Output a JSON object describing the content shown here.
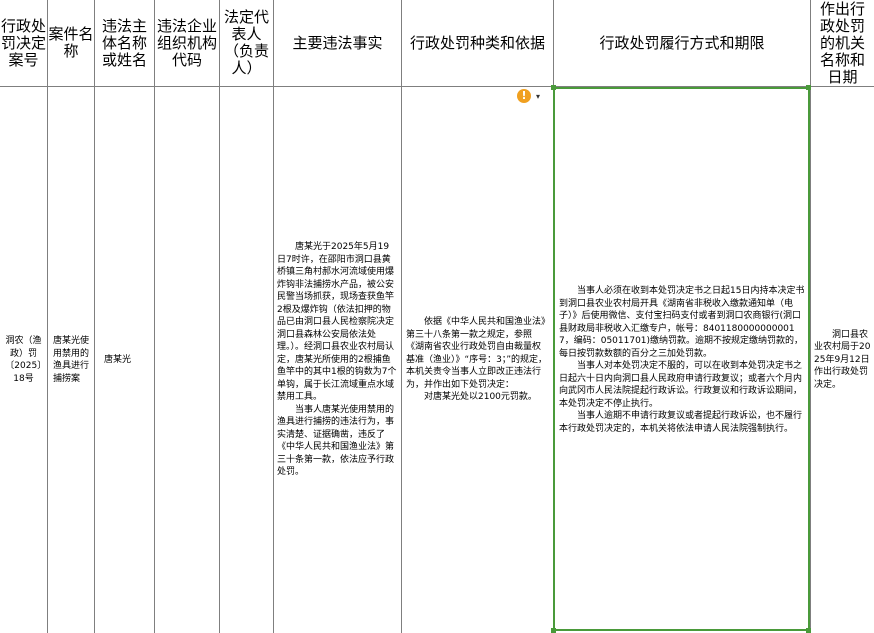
{
  "headers": [
    "行政处罚决定案号",
    "案件名称",
    "违法主体名称或姓名",
    "违法企业组织机构代码",
    "法定代表人（负责人）",
    "主要违法事实",
    "行政处罚种类和依据",
    "行政处罚履行方式和期限",
    "作出行政处罚的机关名称和日期"
  ],
  "row": {
    "case_no": "洞农（渔政）罚〔2025〕18号",
    "case_name": "唐某光使用禁用的渔具进行捕捞案",
    "party_name": "唐某光",
    "org_code": "",
    "legal_rep": "",
    "facts": [
      "唐某光于2025年5月19日7时许，在邵阳市洞口县黄桥镇三角村郝水河流域使用爆炸钩非法捕捞水产品，被公安民警当场抓获，现场查获鱼竿2根及爆炸钩（依法扣押的物品已由洞口县人民检察院决定洞口县森林公安局依法处理。）。经洞口县农业农村局认定，唐某光所使用的2根捕鱼鱼竿中的其中1根的钩数为7个单钩，属于长江流域重点水域禁用工具。",
      "当事人唐某光使用禁用的渔具进行捕捞的违法行为，事实清楚、证据确凿，违反了《中华人民共和国渔业法》第三十条第一款，依法应予行政处罚。"
    ],
    "penalty": [
      "依据《中华人民共和国渔业法》第三十八条第一款之规定，参照《湖南省农业行政处罚自由裁量权基准（渔业）》“序号：3；”的规定，本机关责令当事人立即改正违法行为，并作出如下处罚决定：",
      "对唐某光处以2100元罚款。"
    ],
    "performance": [
      "当事人必须在收到本处罚决定书之日起15日内持本决定书到洞口县农业农村局开具《湖南省非税收入缴款通知单（电子）》后使用微信、支付宝扫码支付或者到洞口农商银行(洞口县财政局非税收入汇缴专户，帐号：84011800000000017，编码：05011701)缴纳罚款。逾期不按规定缴纳罚款的，每日按罚款数额的百分之三加处罚款。",
      "当事人对本处罚决定不服的，可以在收到本处罚决定书之日起六十日内向洞口县人民政府申请行政复议；或者六个月内向武冈市人民法院提起行政诉讼。行政复议和行政诉讼期间，本处罚决定不停止执行。",
      "当事人逾期不申请行政复议或者提起行政诉讼，也不履行本行政处罚决定的，本机关将依法申请人民法院强制执行。"
    ],
    "authority": "洞口县农业农村局于2025年9月12日作出行政处罚决定。"
  },
  "warning_icon": "warning-icon",
  "colors": {
    "grid": "#7f7f7f",
    "selection": "#4a9a3a",
    "warning": "#f0a020"
  }
}
